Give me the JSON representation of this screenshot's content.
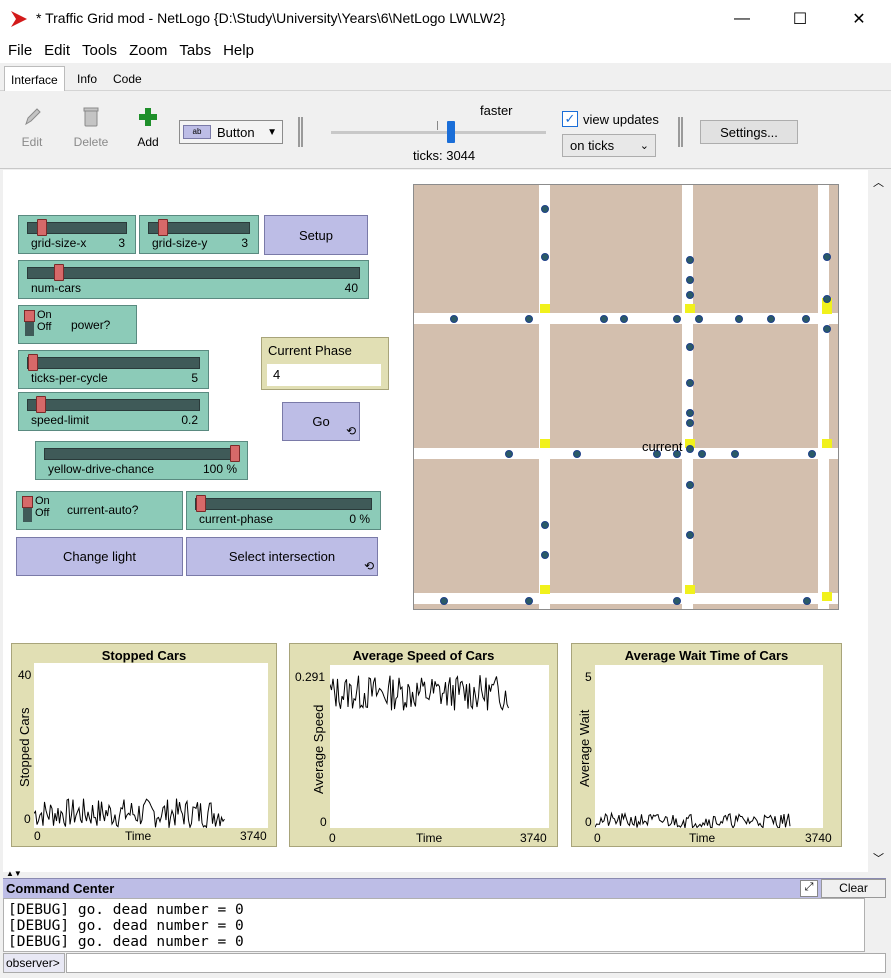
{
  "window": {
    "title": "* Traffic Grid mod - NetLogo {D:\\Study\\University\\Years\\6\\NetLogo LW\\LW2}",
    "minimize": "—",
    "maximize": "☐",
    "close": "✕"
  },
  "menu": [
    "File",
    "Edit",
    "Tools",
    "Zoom",
    "Tabs",
    "Help"
  ],
  "tabs": [
    "Interface",
    "Info",
    "Code"
  ],
  "active_tab": "Interface",
  "toolbar": {
    "edit": "Edit",
    "delete": "Delete",
    "add": "Add",
    "widget_type": "Button",
    "speed_label": "faster",
    "ticks": "ticks: 3044",
    "view_updates_label": "view updates",
    "view_updates_checked": true,
    "update_mode": "on ticks",
    "settings": "Settings..."
  },
  "widgets": {
    "grid_size_x": {
      "name": "grid-size-x",
      "value": "3",
      "fraction": 0.1
    },
    "grid_size_y": {
      "name": "grid-size-y",
      "value": "3",
      "fraction": 0.1
    },
    "setup": "Setup",
    "num_cars": {
      "name": "num-cars",
      "value": "40",
      "fraction": 0.08
    },
    "power": {
      "on": "On",
      "off": "Off",
      "name": "power?"
    },
    "ticks_per_cycle": {
      "name": "ticks-per-cycle",
      "value": "5",
      "fraction": 0.0
    },
    "speed_limit": {
      "name": "speed-limit",
      "value": "0.2",
      "fraction": 0.05
    },
    "current_phase_monitor": {
      "name": "Current Phase",
      "value": "4"
    },
    "go": "Go",
    "yellow_drive_chance": {
      "name": "yellow-drive-chance",
      "value": "100 %",
      "fraction": 1.0
    },
    "current_auto": {
      "on": "On",
      "off": "Off",
      "name": "current-auto?"
    },
    "current_phase": {
      "name": "current-phase",
      "value": "0 %",
      "fraction": 0.0
    },
    "change_light": "Change light",
    "select_intersection": "Select intersection",
    "world_label": "current"
  },
  "plots": [
    {
      "title": "Stopped Cars",
      "ylabel": "Stopped Cars",
      "xlabel": "Time",
      "ymax": "40",
      "ymin": "0",
      "xmin": "0",
      "xmax": "3740"
    },
    {
      "title": "Average Speed of Cars",
      "ylabel": "Average Speed",
      "xlabel": "Time",
      "ymax": "0.291",
      "ymin": "0",
      "xmin": "0",
      "xmax": "3740"
    },
    {
      "title": "Average Wait Time of Cars",
      "ylabel": "Average Wait",
      "xlabel": "Time",
      "ymax": "5",
      "ymin": "0",
      "xmin": "0",
      "xmax": "3740"
    }
  ],
  "command_center": {
    "title": "Command Center",
    "clear": "Clear",
    "output": [
      "[DEBUG] go. dead number = 0",
      "[DEBUG] go. dead number = 0",
      "[DEBUG] go. dead number = 0"
    ],
    "prompt": "observer>"
  },
  "colors": {
    "patch": "#d3bfae",
    "road": "#ffffff",
    "light_yellow": "#f1f11c",
    "slider": "#8ccbb8",
    "button": "#bdbde6",
    "monitor": "#e1dfb4"
  }
}
